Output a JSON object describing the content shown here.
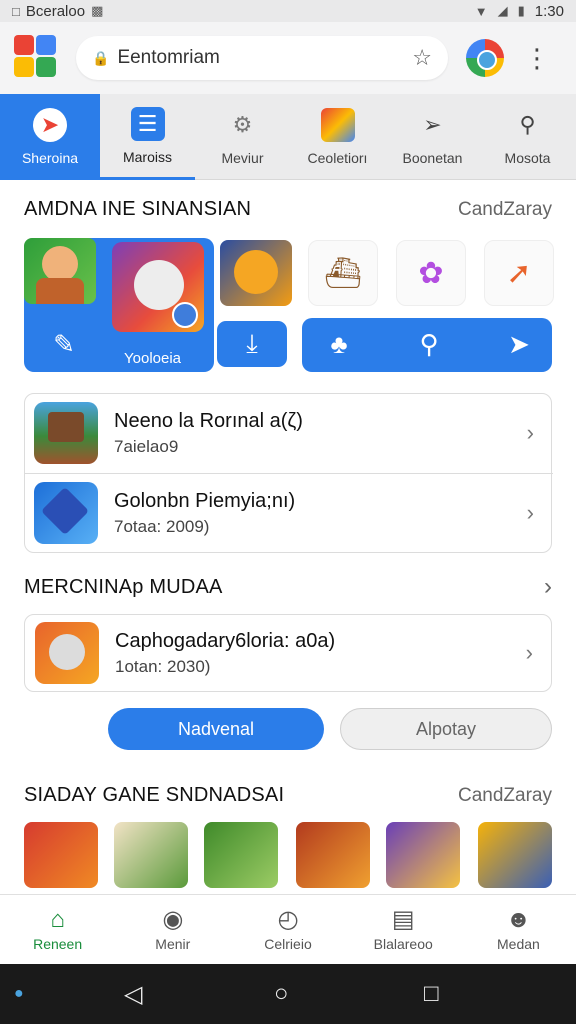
{
  "status_bar": {
    "title": "Bceraloo",
    "time": "1:30"
  },
  "browser": {
    "url_text": "Eentomriam"
  },
  "category_tabs": [
    {
      "label": "Sheroina",
      "icon": "compass-icon"
    },
    {
      "label": "Maroiss",
      "icon": "news-icon"
    },
    {
      "label": "Meviur",
      "icon": "gear-icon"
    },
    {
      "label": "Ceoletiorı",
      "icon": "cube-icon"
    },
    {
      "label": "Boonetan",
      "icon": "rocket-icon"
    },
    {
      "label": "Mosota",
      "icon": "search-icon"
    }
  ],
  "section1": {
    "title": "AMDNA INE SINANSIAN",
    "link": "CandZaray"
  },
  "feature": {
    "panel_label": "Yooloeia"
  },
  "list_items": [
    {
      "title": "Neeno la Rorınal a(ζ)",
      "subtitle": "7aielao9"
    },
    {
      "title": "Golonbn Piemyia;nı)",
      "subtitle": "7otaa: 2009)"
    }
  ],
  "section2": {
    "title": "MERCNINAp MUDAA"
  },
  "list_items2": [
    {
      "title": "Caphogadary6loria: a0a)",
      "subtitle": "1otan: 2030)"
    }
  ],
  "buttons": {
    "primary": "Nadvenal",
    "secondary": "Alpotay"
  },
  "section3": {
    "title": "SIADAY GANE SNDNADSAI",
    "link": "CandZaray"
  },
  "bottom_nav": [
    {
      "label": "Reneen",
      "icon": "home-icon"
    },
    {
      "label": "Menir",
      "icon": "store-icon"
    },
    {
      "label": "Celrieio",
      "icon": "clock-icon"
    },
    {
      "label": "Blalareoo",
      "icon": "list-icon"
    },
    {
      "label": "Medan",
      "icon": "user-icon"
    }
  ],
  "colors": {
    "accent": "#2b7de9",
    "nav_active": "#1a8d3c"
  }
}
